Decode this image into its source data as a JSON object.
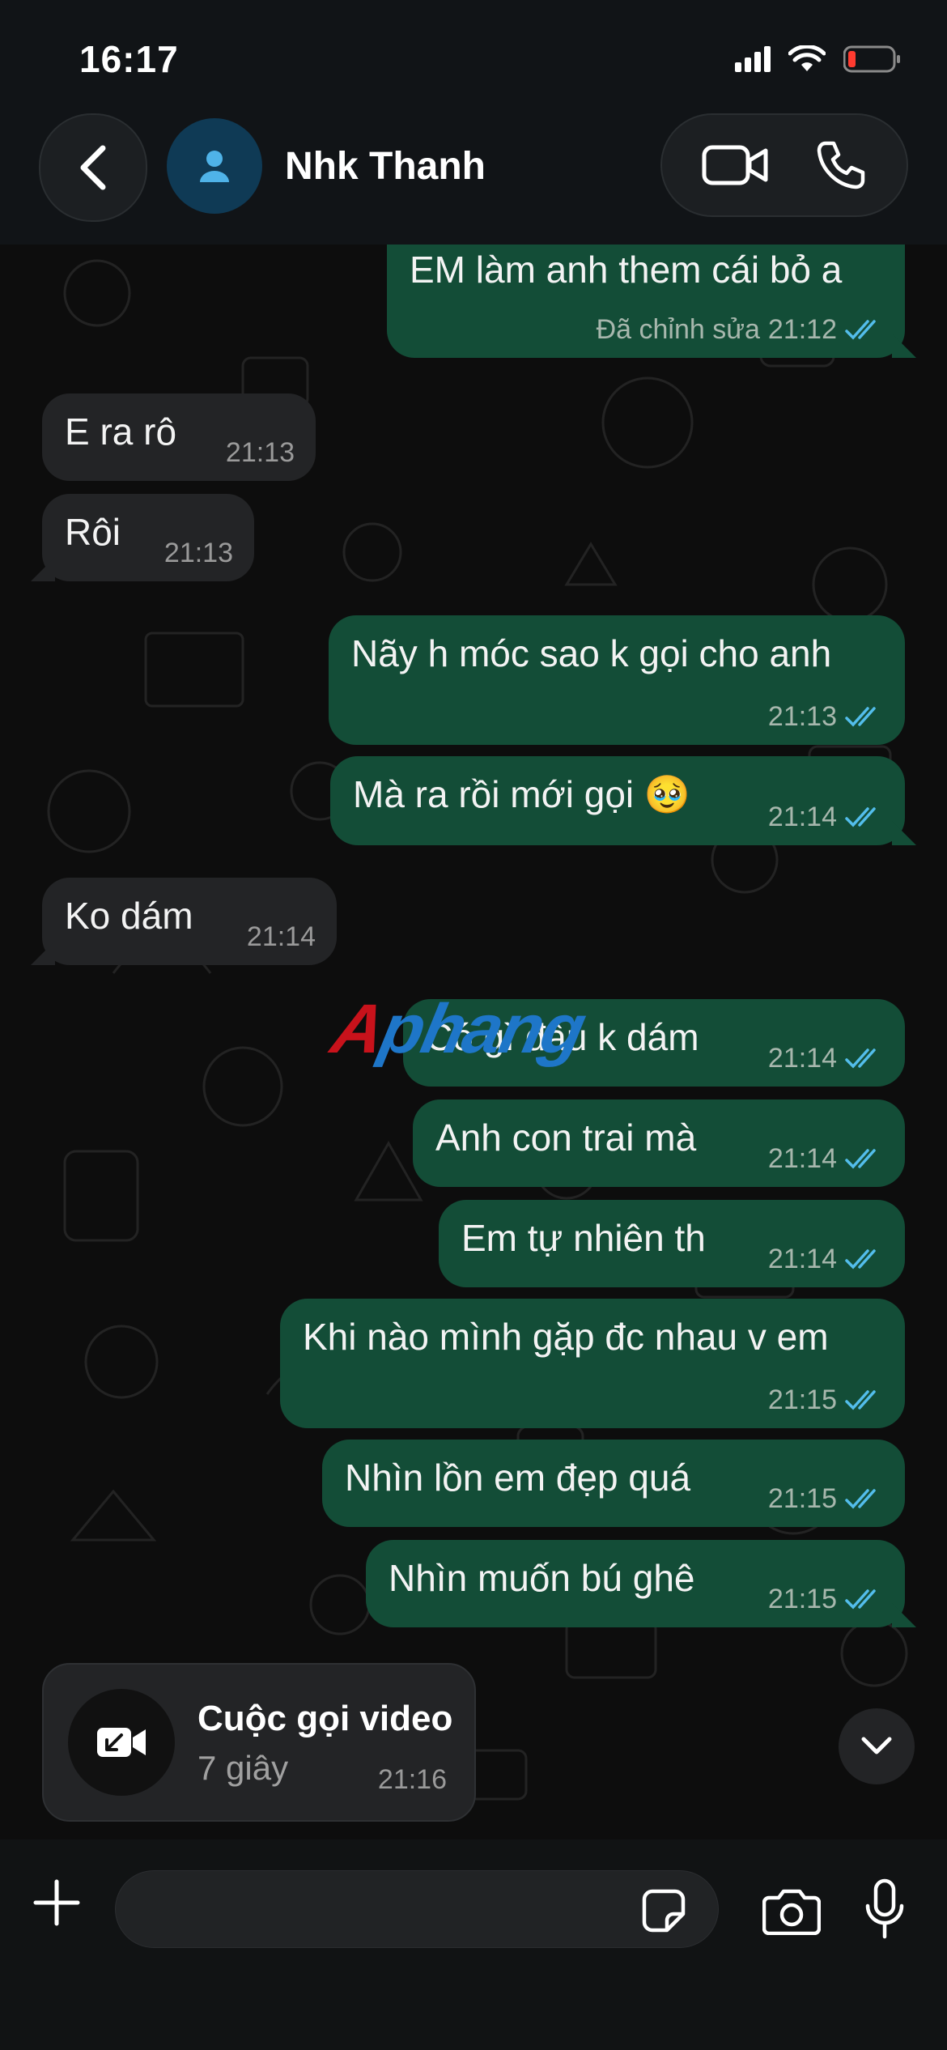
{
  "status_bar": {
    "time": "16:17"
  },
  "header": {
    "contact_name": "Nhk Thanh"
  },
  "messages": [
    {
      "text": "EM làm anh them cái bỏ a",
      "edited_label": "Đã chỉnh sửa",
      "time": "21:12"
    },
    {
      "text": "E ra rô",
      "time": "21:13"
    },
    {
      "text": "Rôi",
      "time": "21:13"
    },
    {
      "text": "Nãy h móc sao k gọi cho anh",
      "time": "21:13"
    },
    {
      "text": "Mà ra rồi mới gọi 🥹",
      "time": "21:14"
    },
    {
      "text": "Ko dám",
      "time": "21:14"
    },
    {
      "text": "Có gì đâu k dám",
      "time": "21:14"
    },
    {
      "text": "Anh con trai mà",
      "time": "21:14"
    },
    {
      "text": "Em tự nhiên th",
      "time": "21:14"
    },
    {
      "text": "Khi nào mình gặp đc nhau v em",
      "time": "21:15"
    },
    {
      "text": "Nhìn lồn em đẹp quá",
      "time": "21:15"
    },
    {
      "text": "Nhìn muốn bú ghê",
      "time": "21:15"
    }
  ],
  "call_card": {
    "title": "Cuộc gọi video",
    "duration": "7 giây",
    "time": "21:16"
  },
  "watermark": {
    "part1": "A",
    "part2": "phang"
  },
  "input": {
    "placeholder": ""
  },
  "colors": {
    "outgoing_bubble": "#134d37",
    "incoming_bubble": "#232426",
    "read_ticks": "#53bdeb"
  }
}
